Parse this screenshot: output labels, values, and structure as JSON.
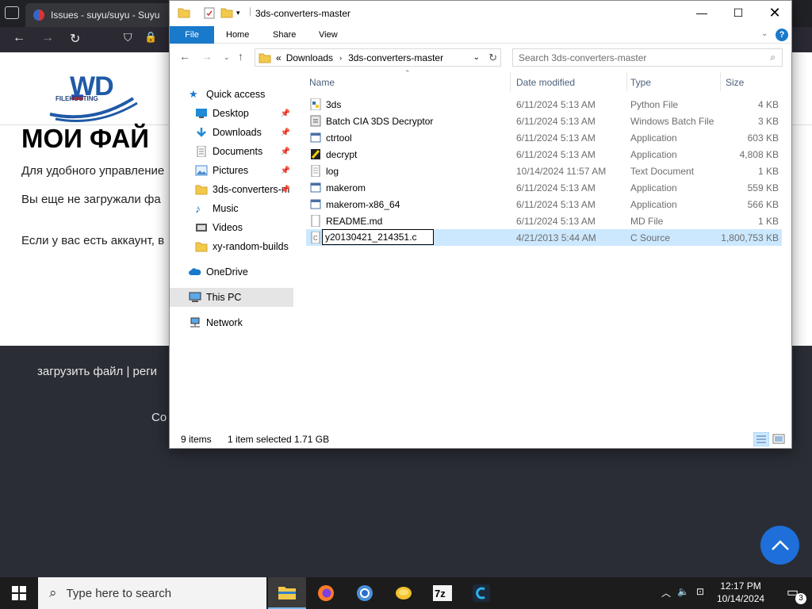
{
  "browser": {
    "tab_title": "Issues - suyu/suyu - Suyu",
    "back_glyph": "←",
    "forward_glyph": "→",
    "reload_glyph": "↻"
  },
  "site": {
    "logo_text": "WD",
    "logo_sub": "FILEHOSTING",
    "title": "МОИ ФАЙ",
    "p1": "Для удобного управление",
    "p2": "Вы еще не загружали фа",
    "p3": "Если у вас есть аккаунт, в",
    "footer_links": "загрузить файл  |  реги",
    "footer_copy": "Co"
  },
  "explorer": {
    "title": "3ds-converters-master",
    "ribbon": {
      "file": "File",
      "home": "Home",
      "share": "Share",
      "view": "View",
      "help": "?"
    },
    "address": {
      "prefix": "«",
      "crumbs": [
        "Downloads",
        "3ds-converters-master"
      ]
    },
    "search_placeholder": "Search 3ds-converters-master",
    "nav": [
      {
        "label": "Quick access",
        "icon": "star-icon"
      },
      {
        "label": "Desktop",
        "icon": "desktop-icon",
        "pinned": true
      },
      {
        "label": "Downloads",
        "icon": "download-icon",
        "pinned": true
      },
      {
        "label": "Documents",
        "icon": "document-icon",
        "pinned": true
      },
      {
        "label": "Pictures",
        "icon": "picture-icon",
        "pinned": true
      },
      {
        "label": "3ds-converters-m",
        "icon": "folder-icon",
        "pinned": true
      },
      {
        "label": "Music",
        "icon": "music-icon"
      },
      {
        "label": "Videos",
        "icon": "video-icon"
      },
      {
        "label": "xy-random-builds",
        "icon": "folder-icon"
      },
      {
        "label": "OneDrive",
        "icon": "cloud-icon"
      },
      {
        "label": "This PC",
        "icon": "pc-icon",
        "selected": true
      },
      {
        "label": "Network",
        "icon": "network-icon"
      }
    ],
    "columns": {
      "name": "Name",
      "date": "Date modified",
      "type": "Type",
      "size": "Size"
    },
    "files": [
      {
        "name": "3ds",
        "date": "6/11/2024 5:13 AM",
        "type": "Python File",
        "size": "4 KB"
      },
      {
        "name": "Batch CIA 3DS Decryptor",
        "date": "6/11/2024 5:13 AM",
        "type": "Windows Batch File",
        "size": "3 KB"
      },
      {
        "name": "ctrtool",
        "date": "6/11/2024 5:13 AM",
        "type": "Application",
        "size": "603 KB"
      },
      {
        "name": "decrypt",
        "date": "6/11/2024 5:13 AM",
        "type": "Application",
        "size": "4,808 KB"
      },
      {
        "name": "log",
        "date": "10/14/2024 11:57 AM",
        "type": "Text Document",
        "size": "1 KB"
      },
      {
        "name": "makerom",
        "date": "6/11/2024 5:13 AM",
        "type": "Application",
        "size": "559 KB"
      },
      {
        "name": "makerom-x86_64",
        "date": "6/11/2024 5:13 AM",
        "type": "Application",
        "size": "566 KB"
      },
      {
        "name": "README.md",
        "date": "6/11/2024 5:13 AM",
        "type": "MD File",
        "size": "1 KB"
      },
      {
        "name": "y20130421_214351.c",
        "date": "4/21/2013 5:44 AM",
        "type": "C Source",
        "size": "1,800,753 KB",
        "selected": true,
        "renaming": true
      }
    ],
    "status": {
      "items": "9 items",
      "selected": "1 item selected  1.71 GB"
    }
  },
  "taskbar": {
    "search_placeholder": "Type here to search",
    "time": "12:17 PM",
    "date": "10/14/2024",
    "notif_count": "3"
  }
}
